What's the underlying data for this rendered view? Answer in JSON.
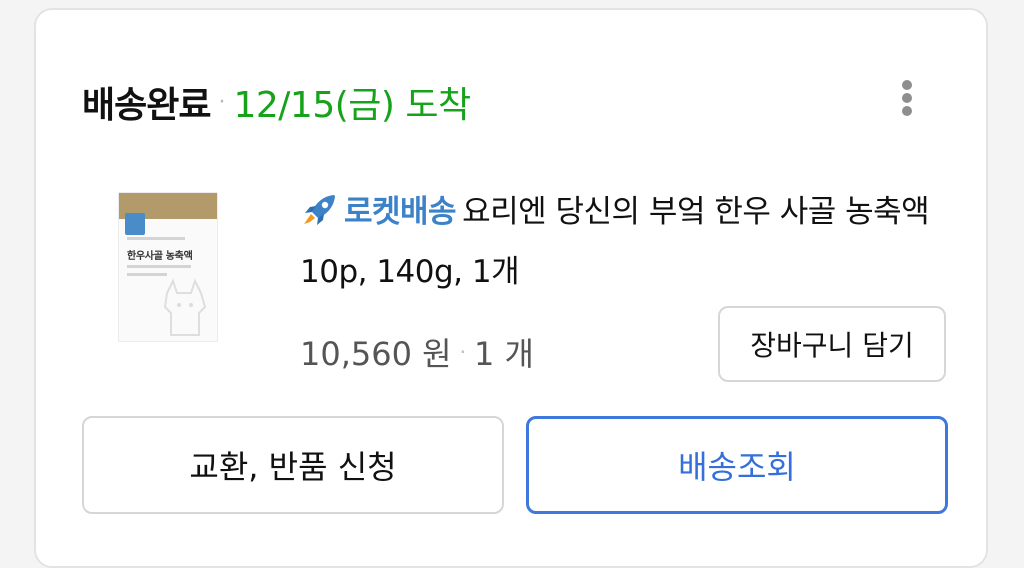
{
  "order": {
    "status": "배송완료",
    "separator": "·",
    "arrival": "12/15(금) 도착"
  },
  "product": {
    "badge": "로켓배송",
    "name": "요리엔 당신의 부엌 한우 사골 농축액 10p, 140g, 1개",
    "thumbnail_label": "한우사골 농축액",
    "price": "10,560 원",
    "quantity": "1 개"
  },
  "actions": {
    "add_to_cart": "장바구니 담기",
    "exchange_return": "교환, 반품 신청",
    "track_delivery": "배송조회"
  },
  "icons": {
    "more": "more-vertical-icon",
    "rocket": "rocket-icon"
  },
  "colors": {
    "arrival_green": "#17a21b",
    "rocket_blue": "#3c82c8",
    "primary_blue": "#346fda"
  }
}
